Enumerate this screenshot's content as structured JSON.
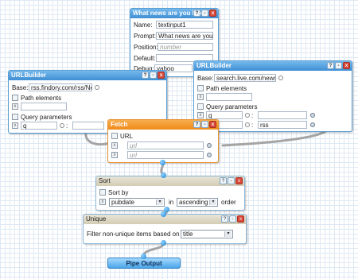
{
  "textinput": {
    "title": "What news are you loo",
    "name_label": "Name:",
    "name_value": "textinput1",
    "prompt_label": "Prompt:",
    "prompt_value": "What news are you loo",
    "position_label": "Position:",
    "position_placeholder": "number",
    "default_label": "Default:",
    "default_value": "",
    "debug_label": "Debug:",
    "debug_value": "yahoo"
  },
  "urlbuilder1": {
    "title": "URLBuilder",
    "base_label": "Base:",
    "base_value": "rss.findory.com/rss/Ne",
    "path_label": "Path elements",
    "path_value": "",
    "query_label": "Query parameters",
    "query_key": "q",
    "query_value": ""
  },
  "urlbuilder2": {
    "title": "URLBuilder",
    "base_label": "Base:",
    "base_value": "search.live.com/news/",
    "path_label": "Path elements",
    "path_value": "",
    "query_label": "Query parameters",
    "q1_key": "q",
    "q1_value": "",
    "q2_key": "mat",
    "q2_value": "rss"
  },
  "fetch": {
    "title": "Fetch",
    "url_label": "URL",
    "url1_placeholder": "url",
    "url2_placeholder": "url"
  },
  "sort": {
    "title": "Sort",
    "sortby_label": "Sort by",
    "field_value": "pubdate",
    "in_label": "in",
    "order_value": "ascending",
    "order_label": "order"
  },
  "unique": {
    "title": "Unique",
    "label": "Filter non-unique items based on",
    "field_value": "title"
  },
  "pipe_output": {
    "label": "Pipe Output"
  },
  "title_buttons": {
    "help": "?",
    "min": "-",
    "close": "x"
  },
  "icons": {
    "checkbox": "x"
  },
  "colors": {
    "module_blue": "#3f8fd4",
    "fetch_orange": "#ef8a1a",
    "wire": "#9a9a9a",
    "terminal_blue": "#1a7fd0"
  }
}
